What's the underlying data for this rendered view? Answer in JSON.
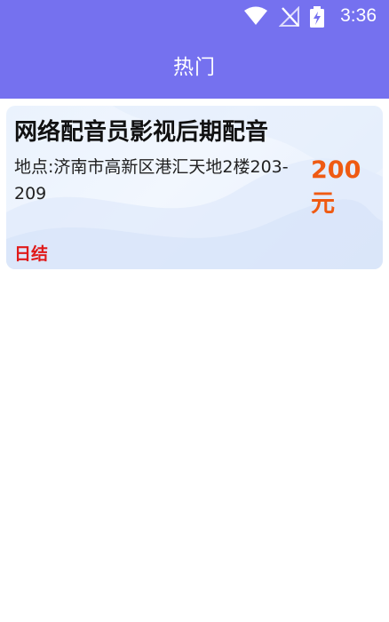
{
  "status_bar": {
    "time": "3:36",
    "icons": [
      "wifi-icon",
      "no-signal-icon",
      "battery-charging-icon"
    ]
  },
  "app_bar": {
    "title": "热门",
    "color": "#7571ef"
  },
  "jobs": [
    {
      "title": "网络配音员影视后期配音",
      "location": "地点:济南市高新区港汇天地2楼203-209",
      "salary": "200元",
      "tag": "日结"
    }
  ],
  "colors": {
    "accent": "#7571ef",
    "salary": "#ef5a12",
    "tag": "#e01a1a",
    "card_background": "#eaf2fd"
  }
}
